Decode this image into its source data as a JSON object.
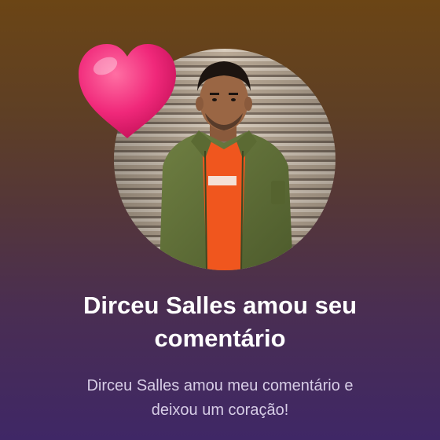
{
  "notification": {
    "title_lines": [
      "Dirceu Salles amou seu",
      "comentário"
    ],
    "message_lines": [
      "Dirceu Salles amou meu comentário e",
      "deixou um coração!"
    ]
  },
  "icons": {
    "reaction": "heart-icon"
  },
  "colors": {
    "background_top": "#6b4515",
    "background_bottom": "#3f2766",
    "heart": "#f0287a",
    "title_text": "#ffffff",
    "message_text": "#d7cde6"
  }
}
